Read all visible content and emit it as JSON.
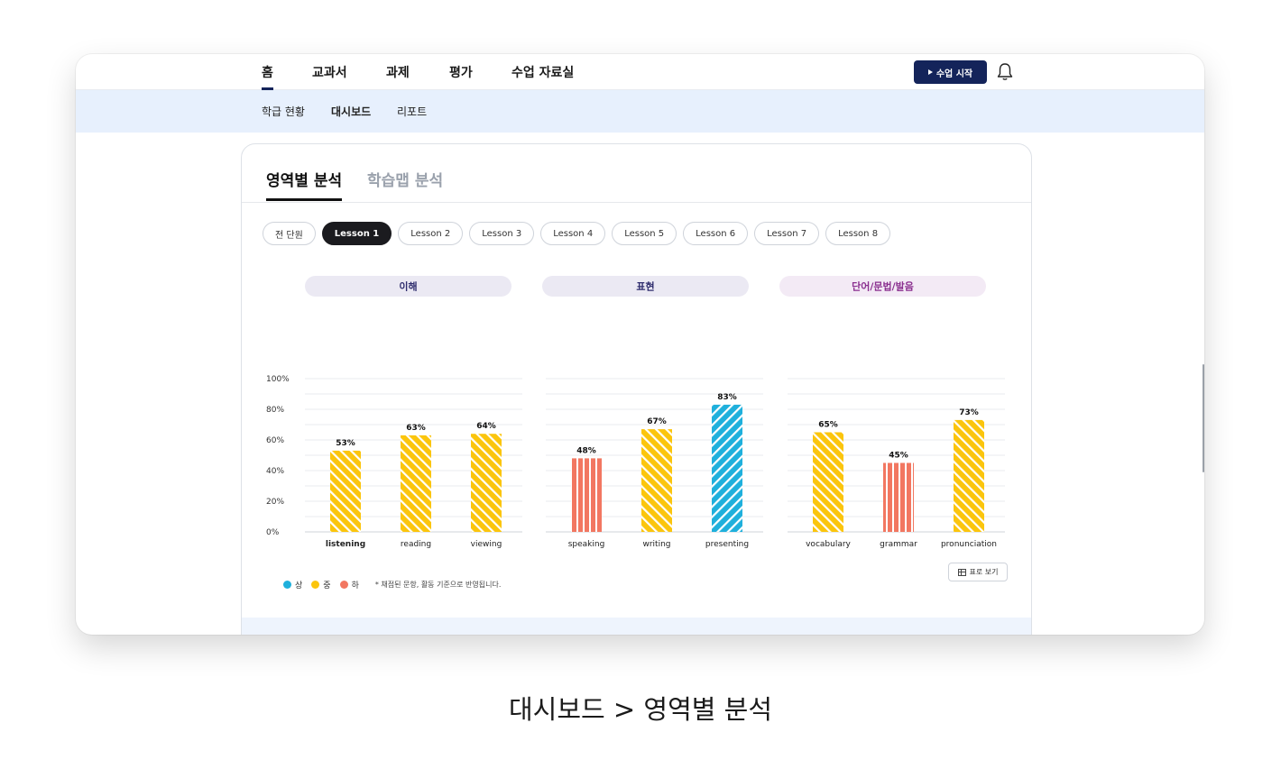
{
  "nav": {
    "items": [
      {
        "label": "홈",
        "active": true
      },
      {
        "label": "교과서",
        "active": false
      },
      {
        "label": "과제",
        "active": false
      },
      {
        "label": "평가",
        "active": false
      },
      {
        "label": "수업 자료실",
        "active": false
      }
    ],
    "start_button": "수업 시작",
    "bell_icon": "bell-icon"
  },
  "subnav": {
    "items": [
      {
        "label": "학급 현황",
        "active": false
      },
      {
        "label": "대시보드",
        "active": true
      },
      {
        "label": "리포트",
        "active": false
      }
    ]
  },
  "tabs": [
    {
      "label": "영역별 분석",
      "active": true
    },
    {
      "label": "학습맵 분석",
      "active": false
    }
  ],
  "lessons": [
    {
      "label": "전 단원",
      "active": false
    },
    {
      "label": "Lesson 1",
      "active": true
    },
    {
      "label": "Lesson 2",
      "active": false
    },
    {
      "label": "Lesson 3",
      "active": false
    },
    {
      "label": "Lesson 4",
      "active": false
    },
    {
      "label": "Lesson 5",
      "active": false
    },
    {
      "label": "Lesson 6",
      "active": false
    },
    {
      "label": "Lesson 7",
      "active": false
    },
    {
      "label": "Lesson 8",
      "active": false
    }
  ],
  "chart_data": {
    "type": "bar",
    "ylim": [
      0,
      100
    ],
    "yticks": [
      "0%",
      "20%",
      "40%",
      "60%",
      "80%",
      "100%"
    ],
    "groups": [
      {
        "title": "이해",
        "categories": [
          "listening",
          "reading",
          "viewing"
        ],
        "values": [
          53,
          63,
          64
        ],
        "levels": [
          "중",
          "중",
          "중"
        ],
        "bold_category": "listening"
      },
      {
        "title": "표현",
        "categories": [
          "speaking",
          "writing",
          "presenting"
        ],
        "values": [
          48,
          67,
          83
        ],
        "levels": [
          "하",
          "중",
          "상"
        ]
      },
      {
        "title": "단어/문법/발음",
        "categories": [
          "vocabulary",
          "grammar",
          "pronunciation"
        ],
        "values": [
          65,
          45,
          73
        ],
        "levels": [
          "중",
          "하",
          "중"
        ]
      }
    ],
    "level_colors": {
      "상": "#1fb0dc",
      "중": "#fbc50d",
      "하": "#f27761"
    }
  },
  "legend": {
    "items": [
      {
        "label": "상",
        "color": "#1fb0dc"
      },
      {
        "label": "중",
        "color": "#fbc50d"
      },
      {
        "label": "하",
        "color": "#f27761"
      }
    ],
    "note": "* 채점된 문항, 활동 기준으로 반영됩니다."
  },
  "table_button": "표로 보기",
  "caption": "대시보드 > 영역별 분석"
}
